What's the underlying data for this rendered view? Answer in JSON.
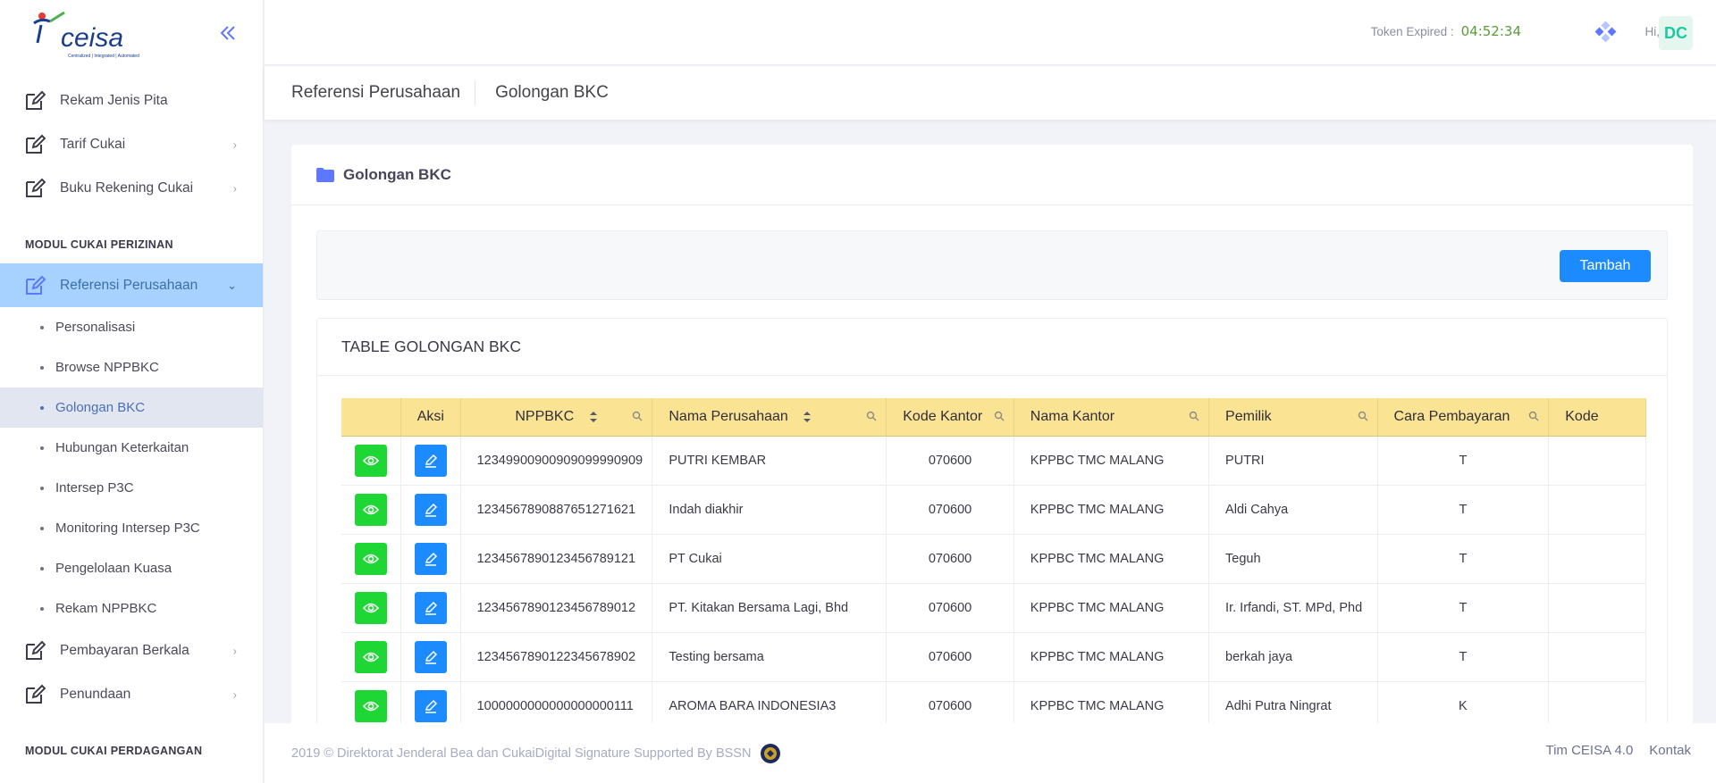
{
  "app": {
    "brand": "CEISA",
    "tagline": "Centralized | Integrated | Automated"
  },
  "sidebar": {
    "items_top": [
      {
        "label": "Rekam Jenis Pita",
        "has_arrow": false
      },
      {
        "label": "Tarif Cukai",
        "has_arrow": true
      },
      {
        "label": "Buku Rekening Cukai",
        "has_arrow": true
      }
    ],
    "section_perizinan": "MODUL CUKAI PERIZINAN",
    "active_item": "Referensi Perusahaan",
    "sub_items": [
      "Personalisasi",
      "Browse NPPBKC",
      "Golongan BKC",
      "Hubungan Keterkaitan",
      "Intersep P3C",
      "Monitoring Intersep P3C",
      "Pengelolaan Kuasa",
      "Rekam NPPBKC"
    ],
    "active_sub": "Golongan BKC",
    "items_bottom": [
      {
        "label": "Pembayaran Berkala",
        "has_arrow": true
      },
      {
        "label": "Penundaan",
        "has_arrow": true
      }
    ],
    "section_perdagangan": "MODUL CUKAI PERDAGANGAN"
  },
  "header": {
    "token_label": "Token Expired :",
    "token_time": "04:52:34",
    "greeting": "Hi,",
    "avatar_initials": "DC"
  },
  "subheader": {
    "title": "Referensi Perusahaan",
    "crumb": "Golongan BKC"
  },
  "portlet": {
    "title": "Golongan BKC",
    "add_button": "Tambah",
    "table_title": "TABLE GOLONGAN BKC"
  },
  "table": {
    "columns": [
      "",
      "Aksi",
      "NPPBKC",
      "Nama Perusahaan",
      "Kode Kantor",
      "Nama Kantor",
      "Pemilik",
      "Cara Pembayaran",
      "Kode"
    ],
    "rows": [
      [
        "12349900900909099990909",
        "PUTRI KEMBAR",
        "070600",
        "KPPBC TMC MALANG",
        "PUTRI",
        "T"
      ],
      [
        "1234567890887651271621",
        "Indah diakhir",
        "070600",
        "KPPBC TMC MALANG",
        "Aldi Cahya",
        "T"
      ],
      [
        "1234567890123456789121",
        "PT Cukai",
        "070600",
        "KPPBC TMC MALANG",
        "Teguh",
        "T"
      ],
      [
        "1234567890123456789012",
        "PT. Kitakan Bersama Lagi, Bhd",
        "070600",
        "KPPBC TMC MALANG",
        "Ir. Irfandi, ST. MPd, Phd",
        "T"
      ],
      [
        "1234567890122345678902",
        "Testing bersama",
        "070600",
        "KPPBC TMC MALANG",
        "berkah jaya",
        "T"
      ],
      [
        "1000000000000000000111",
        "AROMA BARA INDONESIA3",
        "070600",
        "KPPBC TMC MALANG",
        "Adhi Putra Ningrat",
        "K"
      ]
    ]
  },
  "footer": {
    "copyright": "2019 © Direktorat Jenderal Bea dan CukaiDigital Signature Supported By BSSN",
    "link_team": "Tim CEISA 4.0",
    "link_contact": "Kontak"
  },
  "colors": {
    "accent": "#1c8bff",
    "view_button": "#1ed734",
    "table_header": "#fbe394",
    "active_nav": "#a7d2ff",
    "avatar_text": "#1dc9a0"
  }
}
